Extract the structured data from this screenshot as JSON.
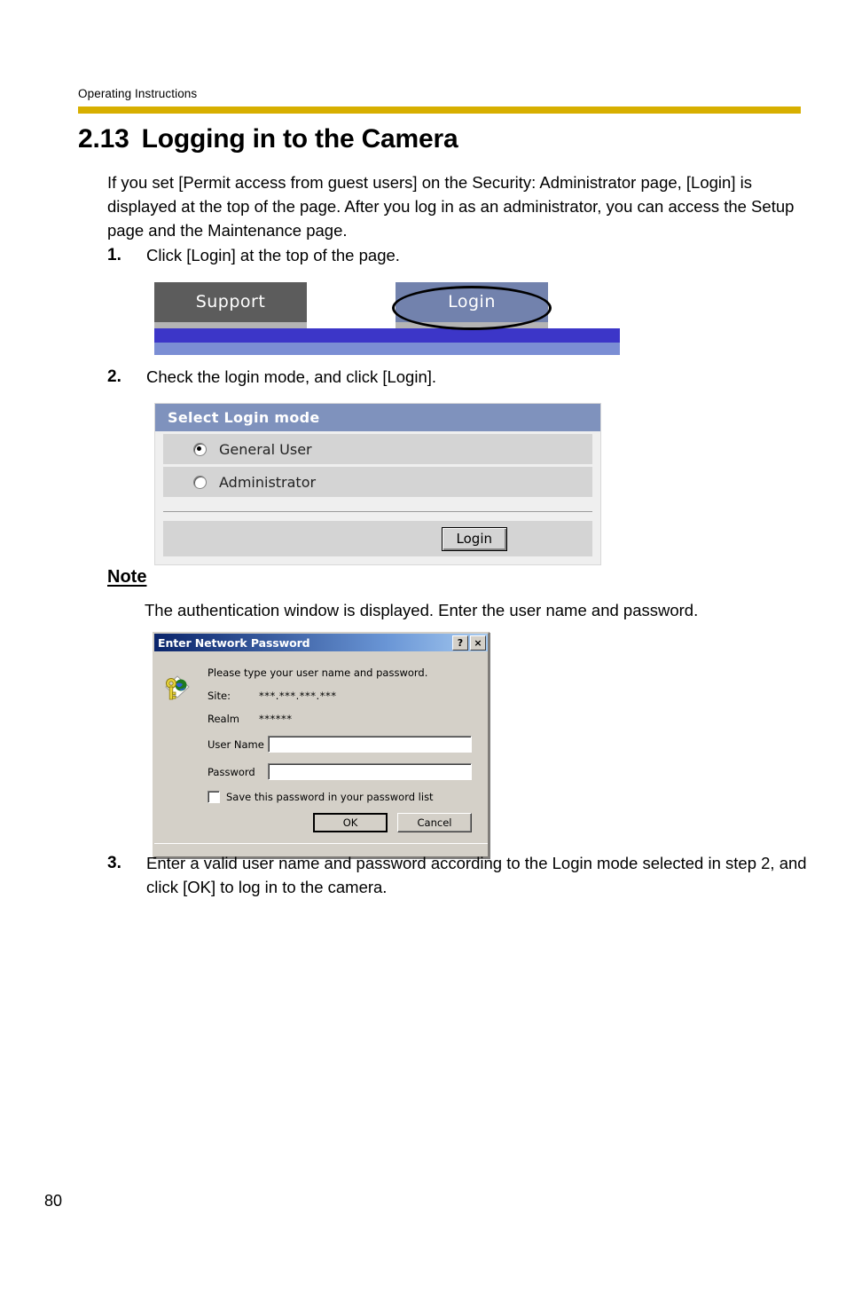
{
  "page": {
    "running_head": "Operating Instructions",
    "page_number": "80",
    "rule_color": "#d7af00"
  },
  "section": {
    "number": "2.13",
    "title": "Logging in to the Camera",
    "intro": "If you set [Permit access from guest users] on the Security: Administrator page, [Login] is displayed at the top of the page. After you log in as an administrator, you can access the Setup page and the Maintenance page."
  },
  "steps": [
    {
      "num": "1.",
      "text": "Click [Login] at the top of the page."
    },
    {
      "num": "2.",
      "text": "Check the login mode, and click [Login]."
    },
    {
      "num": "3.",
      "text": "Enter a valid user name and password according to the Login mode selected in step 2, and click [OK] to log in to the camera."
    }
  ],
  "note": {
    "heading": "Note",
    "body": "The authentication window is displayed. Enter the user name and password."
  },
  "figure_nav": {
    "support_tab": "Support",
    "login_tab": "Login",
    "support_bg": "#5c5c5c",
    "login_bg": "#7282ad",
    "bar_dark": "#3c36c8",
    "bar_light": "#7b8ed4"
  },
  "figure_login_mode": {
    "header": "Select Login mode",
    "header_bg": "#7f92bd",
    "options": [
      {
        "label": "General User",
        "selected": true
      },
      {
        "label": "Administrator",
        "selected": false
      }
    ],
    "login_button": "Login"
  },
  "figure_auth_dialog": {
    "title": "Enter Network Password",
    "help_button": "?",
    "close_button": "×",
    "prompt": "Please type your user name and password.",
    "site_label": "Site:",
    "site_value": "***.***.***.***",
    "realm_label": "Realm",
    "realm_value": "******",
    "username_label": "User Name",
    "username_value": "",
    "password_label": "Password",
    "password_value": "",
    "save_checkbox_label": "Save this password in your password list",
    "save_checkbox_checked": false,
    "ok_button": "OK",
    "cancel_button": "Cancel"
  }
}
